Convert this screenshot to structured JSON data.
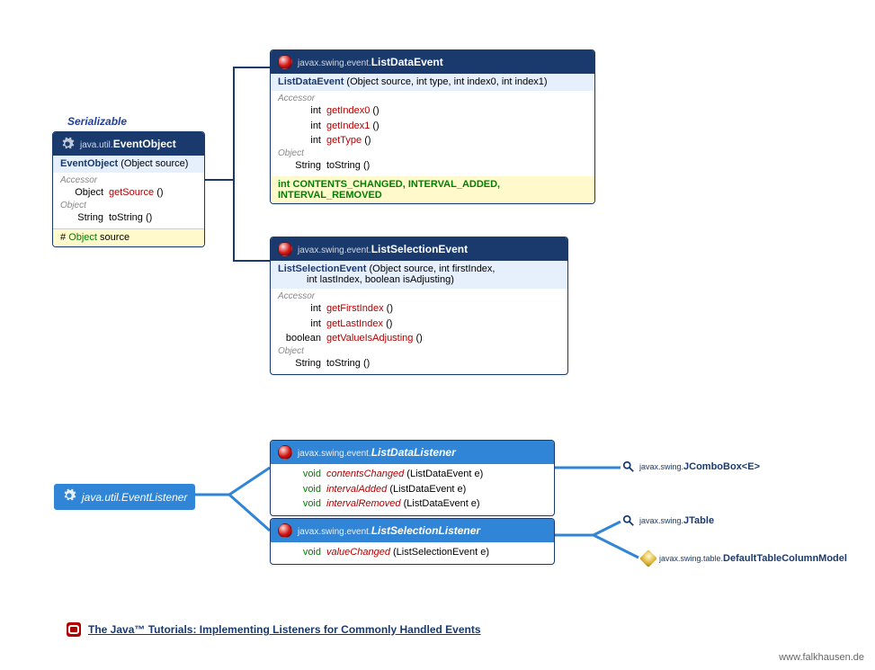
{
  "stereotype": "Serializable",
  "eventObject": {
    "pkg": "java.util.",
    "name": "EventObject",
    "ctor": {
      "name": "EventObject",
      "params": "(Object source)"
    },
    "accessorLabel": "Accessor",
    "accessor": {
      "ret": "Object",
      "name": "getSource",
      "paren": "()"
    },
    "objectLabel": "Object",
    "toString": {
      "ret": "String",
      "name": "toString",
      "paren": "()"
    },
    "field": {
      "prot": "#",
      "type": "Object",
      "name": "source"
    }
  },
  "listDataEvent": {
    "pkg": "javax.swing.event.",
    "name": "ListDataEvent",
    "ctor": {
      "name": "ListDataEvent",
      "params": "(Object source, int type, int index0, int index1)"
    },
    "accessorLabel": "Accessor",
    "m1": {
      "ret": "int",
      "name": "getIndex0",
      "paren": "()"
    },
    "m2": {
      "ret": "int",
      "name": "getIndex1",
      "paren": "()"
    },
    "m3": {
      "ret": "int",
      "name": "getType",
      "paren": "()"
    },
    "objectLabel": "Object",
    "toString": {
      "ret": "String",
      "name": "toString",
      "paren": "()"
    },
    "constants": "int CONTENTS_CHANGED, INTERVAL_ADDED, INTERVAL_REMOVED"
  },
  "listSelectionEvent": {
    "pkg": "javax.swing.event.",
    "name": "ListSelectionEvent",
    "ctorName": "ListSelectionEvent",
    "ctorLine1": "(Object source, int firstIndex,",
    "ctorLine2": "int lastIndex, boolean isAdjusting)",
    "accessorLabel": "Accessor",
    "m1": {
      "ret": "int",
      "name": "getFirstIndex",
      "paren": "()"
    },
    "m2": {
      "ret": "int",
      "name": "getLastIndex",
      "paren": "()"
    },
    "m3": {
      "ret": "boolean",
      "name": "getValueIsAdjusting",
      "paren": "()"
    },
    "objectLabel": "Object",
    "toString": {
      "ret": "String",
      "name": "toString",
      "paren": "()"
    }
  },
  "eventListener": {
    "pkg": "java.util.",
    "name": "EventListener"
  },
  "listDataListener": {
    "pkg": "javax.swing.event.",
    "name": "ListDataListener",
    "m1": {
      "ret": "void",
      "name": "contentsChanged",
      "param": "(ListDataEvent e)"
    },
    "m2": {
      "ret": "void",
      "name": "intervalAdded",
      "param": "(ListDataEvent e)"
    },
    "m3": {
      "ret": "void",
      "name": "intervalRemoved",
      "param": "(ListDataEvent e)"
    }
  },
  "listSelectionListener": {
    "pkg": "javax.swing.event.",
    "name": "ListSelectionListener",
    "m1": {
      "ret": "void",
      "name": "valueChanged",
      "param": "(ListSelectionEvent e)"
    }
  },
  "refs": {
    "combo": {
      "pkg": "javax.swing.",
      "cls": "JComboBox<E>"
    },
    "table": {
      "pkg": "javax.swing.",
      "cls": "JTable"
    },
    "colmodel": {
      "pkg": "javax.swing.table.",
      "cls": "DefaultTableColumnModel"
    }
  },
  "doc": {
    "text": "The Java™ Tutorials: Implementing Listeners for Commonly Handled Events"
  },
  "footer": "www.falkhausen.de"
}
